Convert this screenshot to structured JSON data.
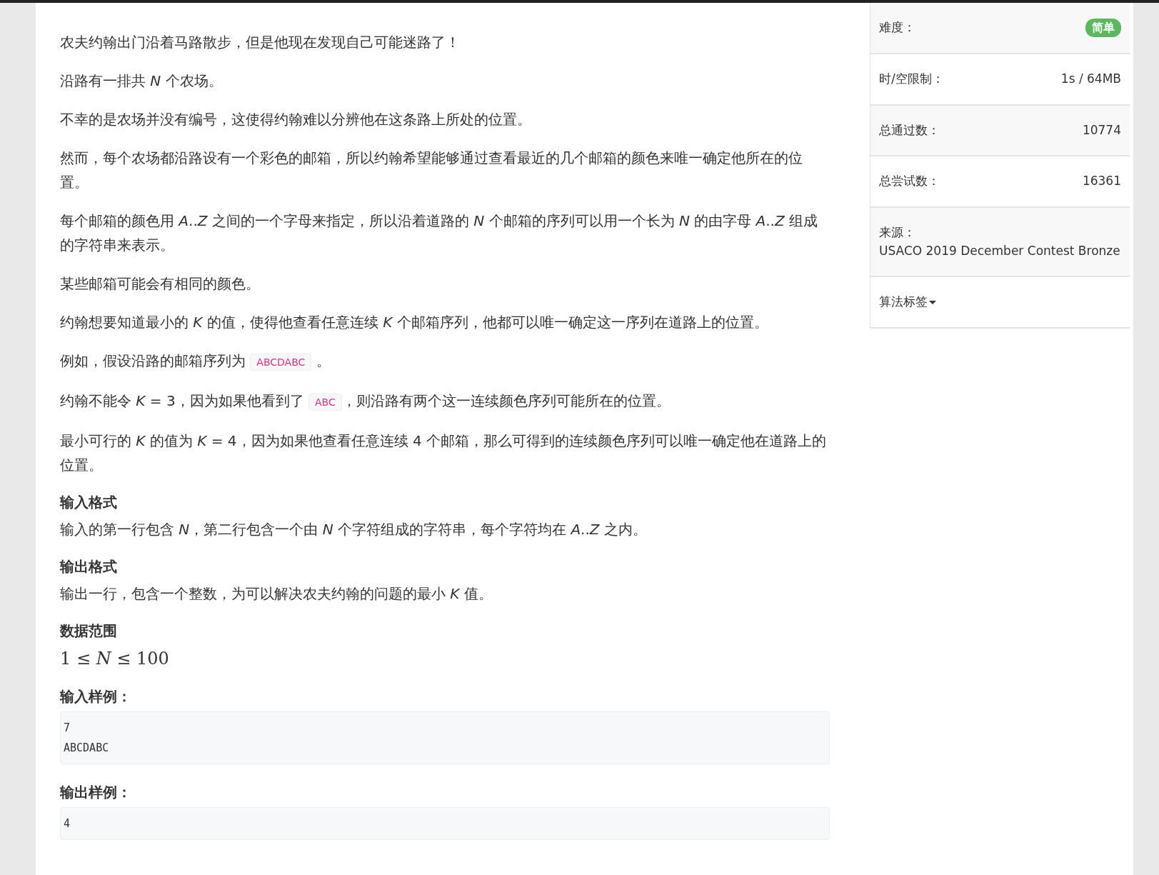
{
  "statement": [
    [
      {
        "kind": "text",
        "text": "农夫约翰出门沿着马路散步，但是他现在发现自己可能迷路了！"
      }
    ],
    [
      {
        "kind": "text",
        "text": "沿路有一排共 *N* 个农场。"
      }
    ],
    [
      {
        "kind": "text",
        "text": "不幸的是农场并没有编号，这使得约翰难以分辨他在这条路上所处的位置。"
      }
    ],
    [
      {
        "kind": "text",
        "text": "然而，每个农场都沿路设有一个彩色的邮箱，所以约翰希望能够通过查看最近的几个邮箱的颜色来唯一确定他所在的位置。"
      }
    ],
    [
      {
        "kind": "text",
        "text": "每个邮箱的颜色用 *A*..*Z* 之间的一个字母来指定，所以沿着道路的 *N* 个邮箱的序列可以用一个长为 *N* 的由字母 *A*..*Z* 组成的字符串来表示。"
      }
    ],
    [
      {
        "kind": "text",
        "text": "某些邮箱可能会有相同的颜色。"
      }
    ],
    [
      {
        "kind": "text",
        "text": "约翰想要知道最小的 *K* 的值，使得他查看任意连续 *K* 个邮箱序列，他都可以唯一确定这一序列在道路上的位置。"
      }
    ],
    [
      {
        "kind": "text",
        "text": "例如，假设沿路的邮箱序列为 "
      },
      {
        "kind": "code",
        "text": "ABCDABC"
      },
      {
        "kind": "text",
        "text": " 。"
      }
    ],
    [
      {
        "kind": "text",
        "text": "约翰不能令 *K* = 3，因为如果他看到了 "
      },
      {
        "kind": "code",
        "text": "ABC"
      },
      {
        "kind": "text",
        "text": "，则沿路有两个这一连续颜色序列可能所在的位置。"
      }
    ],
    [
      {
        "kind": "text",
        "text": "最小可行的 *K* 的值为 *K* = 4，因为如果他查看任意连续 4 个邮箱，那么可得到的连续颜色序列可以唯一确定他在道路上的位置。"
      }
    ]
  ],
  "sections": [
    {
      "heading": "输入格式",
      "kind": "text",
      "body": "输入的第一行包含 *N*，第二行包含一个由 *N* 个字符组成的字符串，每个字符均在 *A*..*Z* 之内。"
    },
    {
      "heading": "输出格式",
      "kind": "text",
      "body": "输出一行，包含一个整数，为可以解决农夫约翰的问题的最小 *K* 值。"
    },
    {
      "heading": "数据范围",
      "kind": "formula",
      "body": "1 ≤ *N* ≤ 100"
    },
    {
      "heading": "输入样例：",
      "kind": "sample",
      "lines": [
        "7",
        "ABCDABC"
      ]
    },
    {
      "heading": "输出样例：",
      "kind": "sample",
      "lines": [
        "4"
      ]
    }
  ],
  "sidebar": [
    {
      "label": "难度：",
      "kind": "badge",
      "value": "简单",
      "color": "#5cb85c"
    },
    {
      "label": "时/空限制：",
      "kind": "value",
      "value": "1s / 64MB"
    },
    {
      "label": "总通过数：",
      "kind": "value",
      "value": "10774"
    },
    {
      "label": "总尝试数：",
      "kind": "value",
      "value": "16361"
    },
    {
      "label": "来源：",
      "kind": "stacked",
      "value": "USACO 2019 December Contest Bronze"
    },
    {
      "label": "算法标签",
      "kind": "dropdown"
    }
  ]
}
